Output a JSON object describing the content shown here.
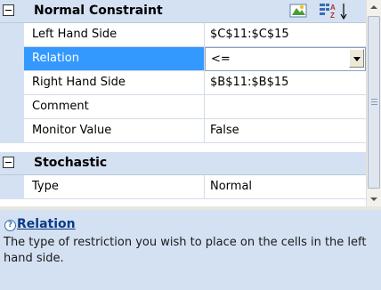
{
  "grid": {
    "categories": [
      {
        "title": "Normal Constraint",
        "rows": [
          {
            "name": "Left Hand Side",
            "value": "$C$11:$C$15"
          },
          {
            "name": "Relation",
            "value": "<="
          },
          {
            "name": "Right Hand Side",
            "value": "$B$11:$B$15"
          },
          {
            "name": "Comment",
            "value": ""
          },
          {
            "name": "Monitor Value",
            "value": "False"
          }
        ]
      },
      {
        "title": "Stochastic",
        "rows": [
          {
            "name": "Type",
            "value": "Normal"
          }
        ]
      }
    ],
    "selected_row": "Relation"
  },
  "toolbar": {
    "categorized_icon": "categorized-view-icon",
    "alphabetical_icon": "alphabetical-sort-icon"
  },
  "help": {
    "title": "Relation",
    "description": "The type of restriction you wish to place on the cells in the left hand side."
  },
  "colors": {
    "category_bg": "#d4e1f2",
    "selection": "#3399ff",
    "help_title": "#0a3a86"
  }
}
